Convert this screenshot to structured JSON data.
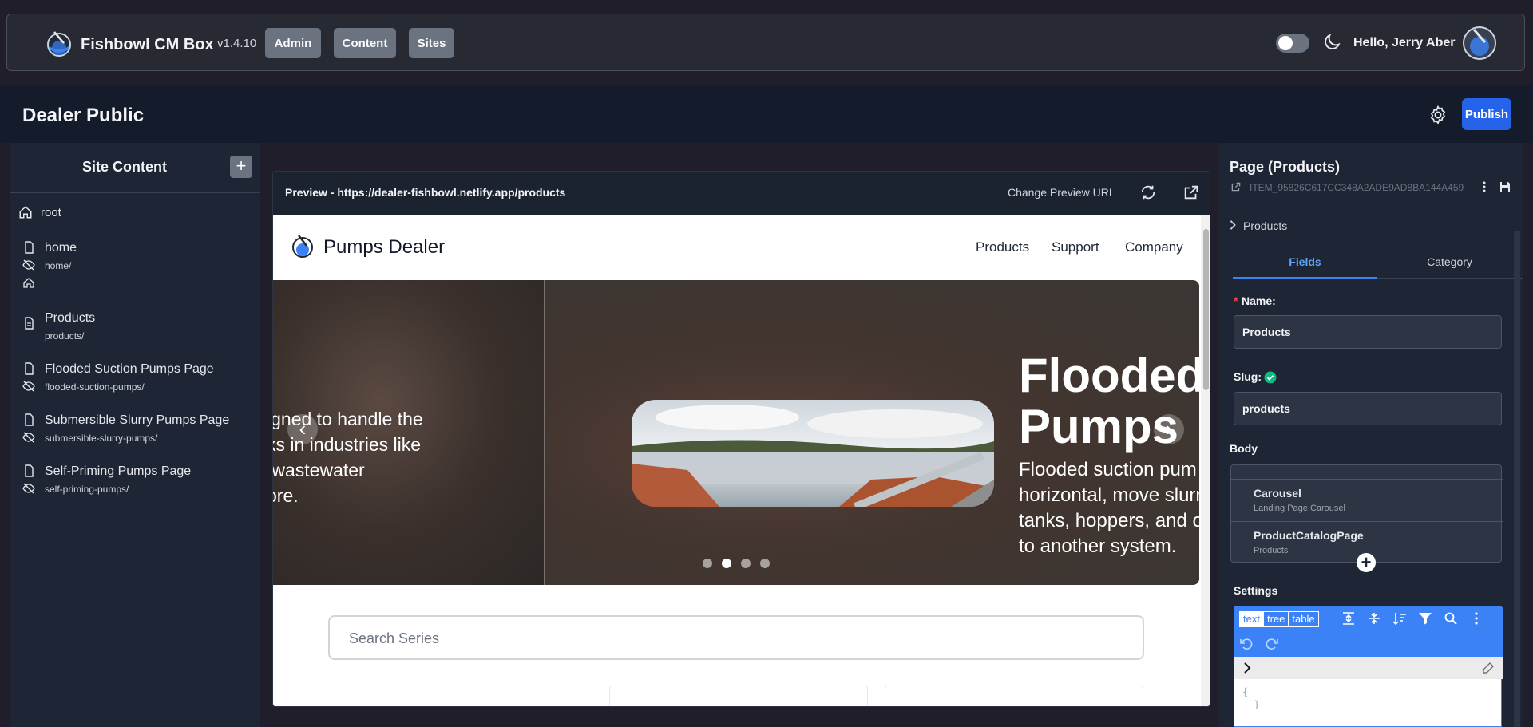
{
  "app": {
    "brand": "Fishbowl CM Box",
    "version": "v1.4.10",
    "nav": [
      "Admin",
      "Content",
      "Sites"
    ],
    "greeting": "Hello, Jerry Aber"
  },
  "page": {
    "title": "Dealer Public",
    "publish_label": "Publish"
  },
  "sidebar": {
    "title": "Site Content",
    "add_label": "+",
    "root_label": "root",
    "items": [
      {
        "name": "home",
        "slug": "home/"
      },
      {
        "name": "Products",
        "slug": "products/"
      },
      {
        "name": "Flooded Suction Pumps Page",
        "slug": "flooded-suction-pumps/"
      },
      {
        "name": "Submersible Slurry Pumps Page",
        "slug": "submersible-slurry-pumps/"
      },
      {
        "name": "Self-Priming Pumps Page",
        "slug": "self-priming-pumps/"
      }
    ]
  },
  "preview": {
    "title": "Preview - https://dealer-fishbowl.netlify.app/products",
    "change_url_label": "Change Preview URL",
    "site": {
      "brand": "Pumps Dealer",
      "nav": [
        "Products",
        "Support",
        "Company"
      ],
      "hero_left_text": "igned to handle the\nks in industries like\n wastewater\nore.",
      "hero_heading": "Flooded\nPumps",
      "hero_paragraph": "Flooded suction pum\nhorizontal, move slurr\ntanks, hoppers, and o\nto another system.",
      "carousel_active_index": 1,
      "carousel_count": 4,
      "search_placeholder": "Search Series"
    }
  },
  "panel": {
    "title": "Page (Products)",
    "item_id": "ITEM_95826C617CC348A2ADE9AD8BA144A459",
    "breadcrumb": "Products",
    "tabs": [
      "Fields",
      "Category"
    ],
    "name_label": "Name:",
    "name_required_mark": "*",
    "name_value": "Products",
    "slug_label": "Slug:",
    "slug_value": "products",
    "body_label": "Body",
    "body_items": [
      {
        "title": "Carousel",
        "subtitle": "Landing Page Carousel"
      },
      {
        "title": "ProductCatalogPage",
        "subtitle": "Products"
      }
    ],
    "settings_label": "Settings",
    "json_modes": [
      "text",
      "tree",
      "table"
    ],
    "json_code": "{\n  }"
  },
  "colors": {
    "accent": "#2563eb",
    "json_toolbar": "#3b82f6",
    "slug_ok": "#10b981"
  }
}
